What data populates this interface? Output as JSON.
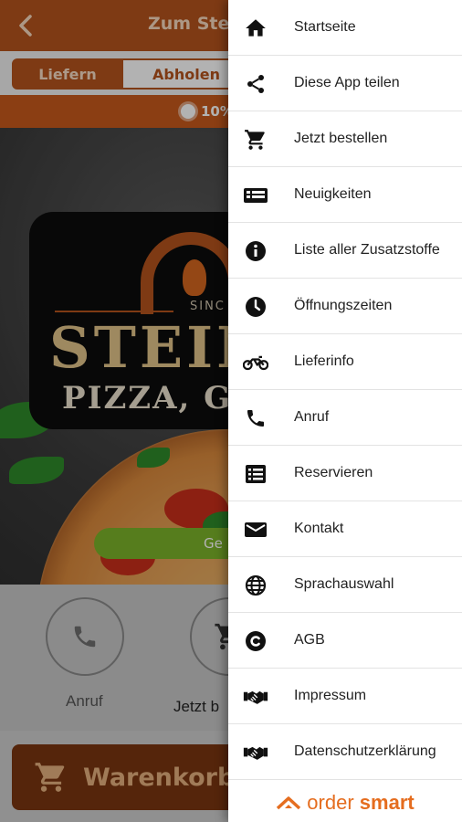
{
  "app": {
    "title": "Zum Stein",
    "segments": {
      "deliver": "Liefern",
      "pickup": "Abholen"
    },
    "promo": "10%",
    "logo": {
      "since": "SINC",
      "name": "STEIN",
      "tagline": "PIZZA, GRI"
    },
    "green_pill": "Ge",
    "actions": {
      "call": "Anruf",
      "order": "Jetzt b"
    },
    "cart": "Warenkorb"
  },
  "drawer": {
    "items": [
      {
        "label": "Startseite",
        "icon": "home-icon"
      },
      {
        "label": "Diese App teilen",
        "icon": "share-icon"
      },
      {
        "label": "Jetzt bestellen",
        "icon": "cart-icon"
      },
      {
        "label": "Neuigkeiten",
        "icon": "news-icon"
      },
      {
        "label": "Liste aller Zusatzstoffe",
        "icon": "info-icon"
      },
      {
        "label": "Öffnungszeiten",
        "icon": "clock-icon"
      },
      {
        "label": "Lieferinfo",
        "icon": "motorbike-icon"
      },
      {
        "label": "Anruf",
        "icon": "phone-icon"
      },
      {
        "label": "Reservieren",
        "icon": "reservation-list-icon"
      },
      {
        "label": "Kontakt",
        "icon": "mail-icon"
      },
      {
        "label": "Sprachauswahl",
        "icon": "globe-icon"
      },
      {
        "label": "AGB",
        "icon": "copyright-icon"
      },
      {
        "label": "Impressum",
        "icon": "handshake-icon"
      },
      {
        "label": "Datenschutzerklärung",
        "icon": "handshake-icon"
      }
    ],
    "footer": {
      "brand_light": "order ",
      "brand_bold": "smart"
    }
  },
  "colors": {
    "accent": "#b5541d",
    "accent_dark": "#7a3610",
    "brand": "#e56d1f",
    "green": "#7cb32a"
  }
}
